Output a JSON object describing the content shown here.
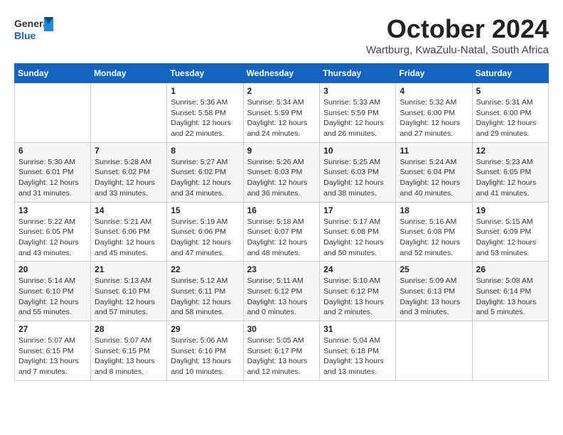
{
  "header": {
    "logo_general": "General",
    "logo_blue": "Blue",
    "month_title": "October 2024",
    "location": "Wartburg, KwaZulu-Natal, South Africa"
  },
  "weekdays": [
    "Sunday",
    "Monday",
    "Tuesday",
    "Wednesday",
    "Thursday",
    "Friday",
    "Saturday"
  ],
  "weeks": [
    [
      {
        "day": "",
        "info": ""
      },
      {
        "day": "",
        "info": ""
      },
      {
        "day": "1",
        "info": "Sunrise: 5:36 AM\nSunset: 5:58 PM\nDaylight: 12 hours and 22 minutes."
      },
      {
        "day": "2",
        "info": "Sunrise: 5:34 AM\nSunset: 5:59 PM\nDaylight: 12 hours and 24 minutes."
      },
      {
        "day": "3",
        "info": "Sunrise: 5:33 AM\nSunset: 5:59 PM\nDaylight: 12 hours and 26 minutes."
      },
      {
        "day": "4",
        "info": "Sunrise: 5:32 AM\nSunset: 6:00 PM\nDaylight: 12 hours and 27 minutes."
      },
      {
        "day": "5",
        "info": "Sunrise: 5:31 AM\nSunset: 6:00 PM\nDaylight: 12 hours and 29 minutes."
      }
    ],
    [
      {
        "day": "6",
        "info": "Sunrise: 5:30 AM\nSunset: 6:01 PM\nDaylight: 12 hours and 31 minutes."
      },
      {
        "day": "7",
        "info": "Sunrise: 5:28 AM\nSunset: 6:02 PM\nDaylight: 12 hours and 33 minutes."
      },
      {
        "day": "8",
        "info": "Sunrise: 5:27 AM\nSunset: 6:02 PM\nDaylight: 12 hours and 34 minutes."
      },
      {
        "day": "9",
        "info": "Sunrise: 5:26 AM\nSunset: 6:03 PM\nDaylight: 12 hours and 36 minutes."
      },
      {
        "day": "10",
        "info": "Sunrise: 5:25 AM\nSunset: 6:03 PM\nDaylight: 12 hours and 38 minutes."
      },
      {
        "day": "11",
        "info": "Sunrise: 5:24 AM\nSunset: 6:04 PM\nDaylight: 12 hours and 40 minutes."
      },
      {
        "day": "12",
        "info": "Sunrise: 5:23 AM\nSunset: 6:05 PM\nDaylight: 12 hours and 41 minutes."
      }
    ],
    [
      {
        "day": "13",
        "info": "Sunrise: 5:22 AM\nSunset: 6:05 PM\nDaylight: 12 hours and 43 minutes."
      },
      {
        "day": "14",
        "info": "Sunrise: 5:21 AM\nSunset: 6:06 PM\nDaylight: 12 hours and 45 minutes."
      },
      {
        "day": "15",
        "info": "Sunrise: 5:19 AM\nSunset: 6:06 PM\nDaylight: 12 hours and 47 minutes."
      },
      {
        "day": "16",
        "info": "Sunrise: 5:18 AM\nSunset: 6:07 PM\nDaylight: 12 hours and 48 minutes."
      },
      {
        "day": "17",
        "info": "Sunrise: 5:17 AM\nSunset: 6:08 PM\nDaylight: 12 hours and 50 minutes."
      },
      {
        "day": "18",
        "info": "Sunrise: 5:16 AM\nSunset: 6:08 PM\nDaylight: 12 hours and 52 minutes."
      },
      {
        "day": "19",
        "info": "Sunrise: 5:15 AM\nSunset: 6:09 PM\nDaylight: 12 hours and 53 minutes."
      }
    ],
    [
      {
        "day": "20",
        "info": "Sunrise: 5:14 AM\nSunset: 6:10 PM\nDaylight: 12 hours and 55 minutes."
      },
      {
        "day": "21",
        "info": "Sunrise: 5:13 AM\nSunset: 6:10 PM\nDaylight: 12 hours and 57 minutes."
      },
      {
        "day": "22",
        "info": "Sunrise: 5:12 AM\nSunset: 6:11 PM\nDaylight: 12 hours and 58 minutes."
      },
      {
        "day": "23",
        "info": "Sunrise: 5:11 AM\nSunset: 6:12 PM\nDaylight: 13 hours and 0 minutes."
      },
      {
        "day": "24",
        "info": "Sunrise: 5:10 AM\nSunset: 6:12 PM\nDaylight: 13 hours and 2 minutes."
      },
      {
        "day": "25",
        "info": "Sunrise: 5:09 AM\nSunset: 6:13 PM\nDaylight: 13 hours and 3 minutes."
      },
      {
        "day": "26",
        "info": "Sunrise: 5:08 AM\nSunset: 6:14 PM\nDaylight: 13 hours and 5 minutes."
      }
    ],
    [
      {
        "day": "27",
        "info": "Sunrise: 5:07 AM\nSunset: 6:15 PM\nDaylight: 13 hours and 7 minutes."
      },
      {
        "day": "28",
        "info": "Sunrise: 5:07 AM\nSunset: 6:15 PM\nDaylight: 13 hours and 8 minutes."
      },
      {
        "day": "29",
        "info": "Sunrise: 5:06 AM\nSunset: 6:16 PM\nDaylight: 13 hours and 10 minutes."
      },
      {
        "day": "30",
        "info": "Sunrise: 5:05 AM\nSunset: 6:17 PM\nDaylight: 13 hours and 12 minutes."
      },
      {
        "day": "31",
        "info": "Sunrise: 5:04 AM\nSunset: 6:18 PM\nDaylight: 13 hours and 13 minutes."
      },
      {
        "day": "",
        "info": ""
      },
      {
        "day": "",
        "info": ""
      }
    ]
  ]
}
